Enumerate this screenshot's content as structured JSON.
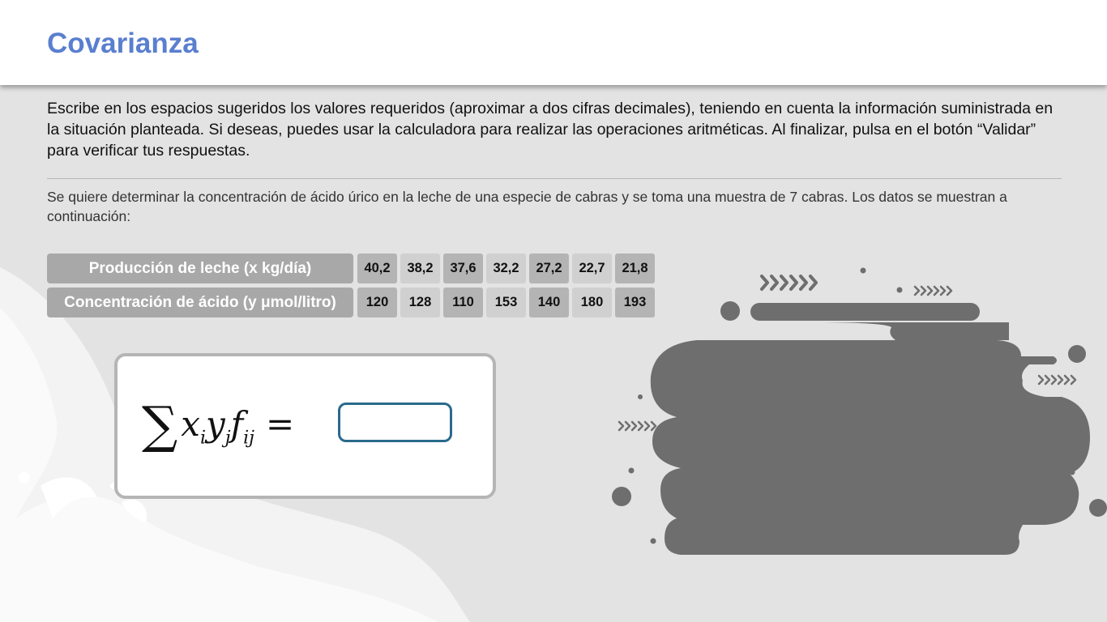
{
  "header": {
    "title": "Covarianza"
  },
  "instructions": "Escribe en los espacios sugeridos los valores requeridos (aproximar a dos cifras decimales), teniendo en cuenta la información suministrada en la situación planteada. Si deseas, puedes usar la calculadora para realizar las operaciones aritméticas. Al finalizar, pulsa en el botón “Validar” para verificar tus respuestas.",
  "situation": "Se quiere determinar la concentración de ácido úrico en la leche de una especie de cabras y se toma una muestra de 7 cabras. Los datos se muestran a continuación:",
  "table": {
    "rows": [
      {
        "label": "Producción de leche (x kg/día)",
        "values": [
          "40,2",
          "38,2",
          "37,6",
          "32,2",
          "27,2",
          "22,7",
          "21,8"
        ]
      },
      {
        "label": "Concentración de ácido (y μmol/litro)",
        "values": [
          "120",
          "128",
          "110",
          "153",
          "140",
          "180",
          "193"
        ]
      }
    ]
  },
  "formula": {
    "sum_symbol": "∑",
    "x": "x",
    "x_sub": "i",
    "y": "y",
    "y_sub": "j",
    "f": "f",
    "f_sub": "ij",
    "equals": "=",
    "answer_value": ""
  },
  "colors": {
    "title": "#5a7fcf",
    "input_border": "#2a6a8c",
    "blob": "#6e6e6e",
    "cell_dark": "#b4b4b4",
    "cell_light": "#d0d0d0",
    "label_bg": "#a8a8a8"
  },
  "icons": [
    "milk-splash-decoration",
    "blob-decoration",
    "chevrons-icon"
  ]
}
